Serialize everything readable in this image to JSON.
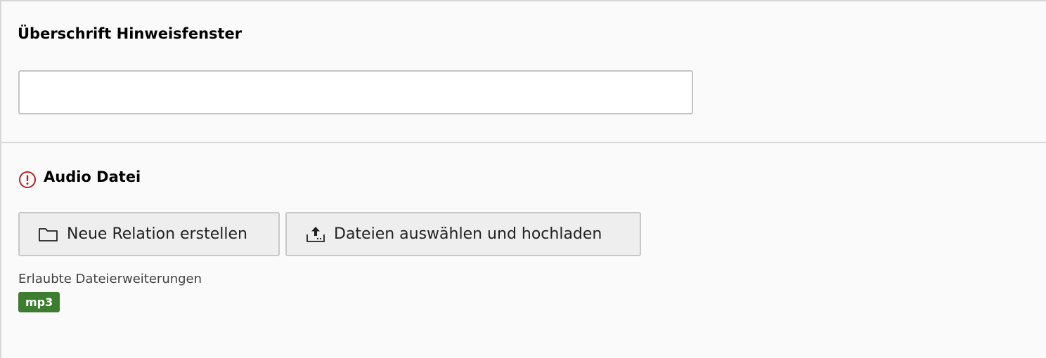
{
  "notice": {
    "heading": "Überschrift Hinweisfenster",
    "input_value": "",
    "input_placeholder": ""
  },
  "audio": {
    "heading": "Audio Datei",
    "warning_icon": "exclamation-circle-icon",
    "warning_color": "#b22222",
    "buttons": {
      "new_relation_label": "Neue Relation erstellen",
      "new_relation_icon": "folder-icon",
      "upload_label": "Dateien auswählen und hochladen",
      "upload_icon": "upload-icon"
    },
    "allowed_extensions_label": "Erlaubte Dateierweiterungen",
    "allowed_extensions": [
      "mp3"
    ],
    "badge_color": "#3d7d2f"
  }
}
